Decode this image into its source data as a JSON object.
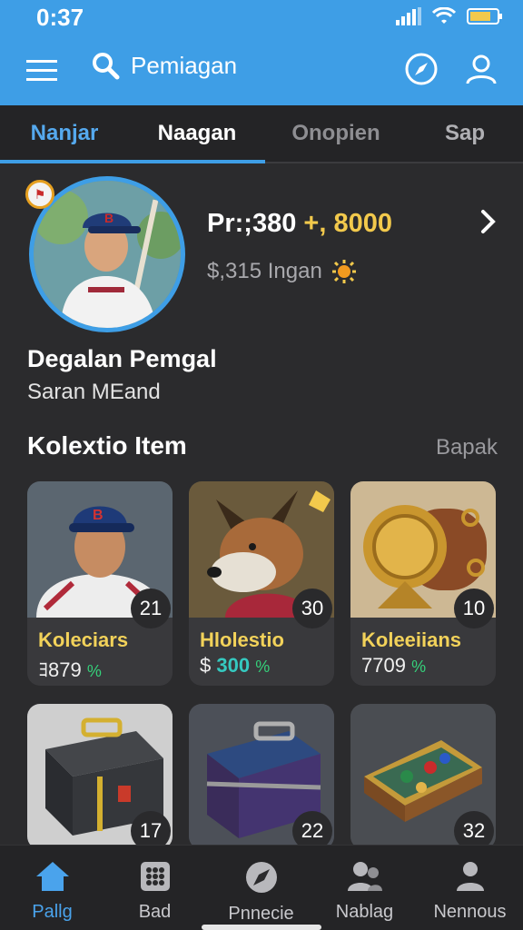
{
  "status": {
    "time": "0:37"
  },
  "topbar": {
    "search_text": "Pemiagan"
  },
  "tabs": [
    {
      "label": "Nanjar",
      "active": true
    },
    {
      "label": "Naagan"
    },
    {
      "label": "Onopien"
    },
    {
      "label": "Sap"
    }
  ],
  "profile": {
    "stats_primary": "Pr:;380",
    "stats_plus": "+, 8000",
    "stats_secondary": "$,315 Ingan",
    "name": "Degalan Pemgal",
    "subtitle": "Saran MEand"
  },
  "collection": {
    "title": "Kolextio Item",
    "link": "Bapak",
    "cards": [
      {
        "count": "21",
        "title": "Koleciars",
        "value": "ﾖ879",
        "pct": "%"
      },
      {
        "count": "30",
        "title": "Hlolestio",
        "value_prefix": "$ ",
        "value": "300",
        "pct": "%"
      },
      {
        "count": "10",
        "title": "Koleeiians",
        "value": "7709",
        "pct": "%"
      }
    ],
    "cards_row2": [
      {
        "count": "17"
      },
      {
        "count": "22"
      },
      {
        "count": "32"
      }
    ]
  },
  "nav": [
    {
      "label": "Pallg",
      "icon": "home-icon",
      "active": true
    },
    {
      "label": "Bad",
      "icon": "grid-icon"
    },
    {
      "label": "Pnnecie",
      "icon": "compass-icon"
    },
    {
      "label": "Nablag",
      "icon": "people-icon"
    },
    {
      "label": "Nennous",
      "icon": "person-icon"
    }
  ],
  "colors": {
    "header": "#3e9ee6",
    "background": "#2b2b2d",
    "card": "#39393c",
    "accent_yellow": "#f2d25a",
    "accent_green": "#35d07a"
  }
}
